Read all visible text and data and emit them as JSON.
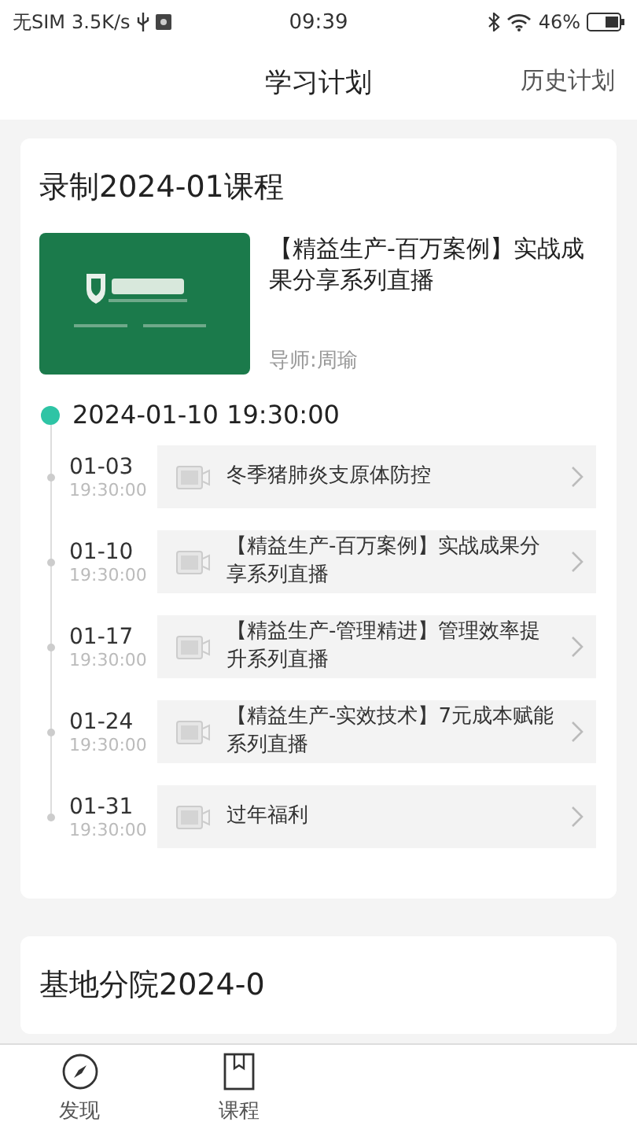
{
  "status_bar": {
    "carrier": "无SIM",
    "speed": "3.5K/s",
    "time": "09:39",
    "battery": "46%"
  },
  "header": {
    "title": "学习计划",
    "action": "历史计划"
  },
  "plans": [
    {
      "title": "录制2024-01课程",
      "course": {
        "name": "【精益生产-百万案例】实战成果分享系列直播",
        "teacher": "导师:周瑜"
      },
      "start": "2024-01-10 19:30:00",
      "lessons": [
        {
          "date": "01-03",
          "time": "19:30:00",
          "name": "冬季猪肺炎支原体防控"
        },
        {
          "date": "01-10",
          "time": "19:30:00",
          "name": "【精益生产-百万案例】实战成果分享系列直播"
        },
        {
          "date": "01-17",
          "time": "19:30:00",
          "name": "【精益生产-管理精进】管理效率提升系列直播"
        },
        {
          "date": "01-24",
          "time": "19:30:00",
          "name": "【精益生产-实效技术】7元成本赋能系列直播"
        },
        {
          "date": "01-31",
          "time": "19:30:00",
          "name": "过年福利"
        }
      ]
    },
    {
      "title": "基地分院2024-0"
    }
  ],
  "nav": [
    {
      "label": "发现"
    },
    {
      "label": "课程"
    }
  ]
}
